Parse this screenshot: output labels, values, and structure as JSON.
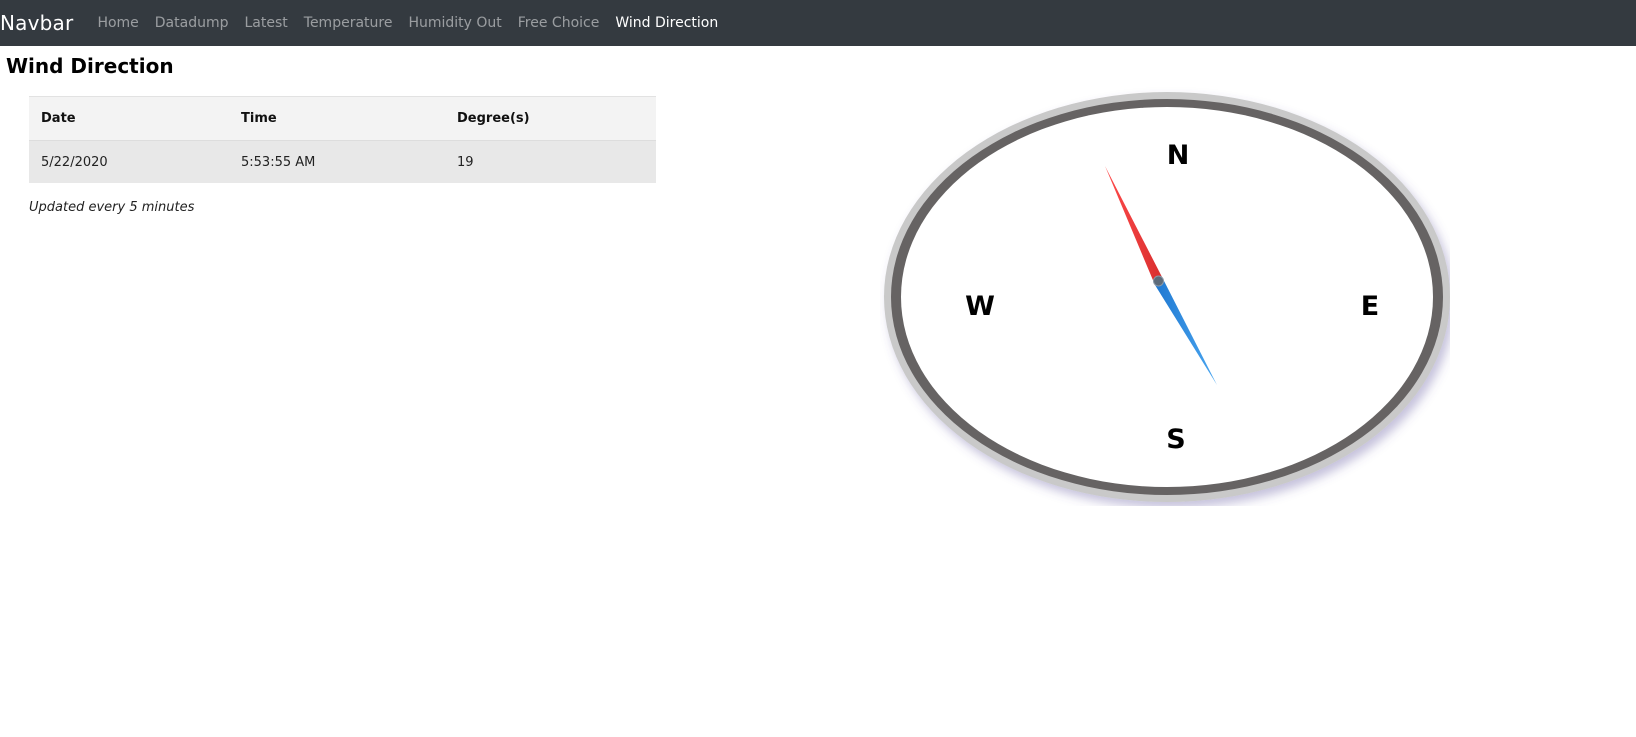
{
  "navbar": {
    "brand": "Navbar",
    "links": [
      {
        "label": "Home",
        "active": false
      },
      {
        "label": "Datadump",
        "active": false
      },
      {
        "label": "Latest",
        "active": false
      },
      {
        "label": "Temperature",
        "active": false
      },
      {
        "label": "Humidity Out",
        "active": false
      },
      {
        "label": "Free Choice",
        "active": false
      },
      {
        "label": "Wind Direction",
        "active": true
      }
    ]
  },
  "page": {
    "title": "Wind Direction",
    "note": "Updated every 5 minutes"
  },
  "table": {
    "headers": [
      "Date",
      "Time",
      "Degree(s)"
    ],
    "rows": [
      [
        "5/22/2020",
        "5:53:55 AM",
        "19"
      ]
    ]
  },
  "compass": {
    "labels": {
      "north": "N",
      "east": "E",
      "south": "S",
      "west": "W"
    },
    "degrees": 19,
    "colors": {
      "north_needle": "#f03c3c",
      "south_needle": "#2f8fe6",
      "ring": "#666363",
      "face": "#ffffff"
    }
  }
}
